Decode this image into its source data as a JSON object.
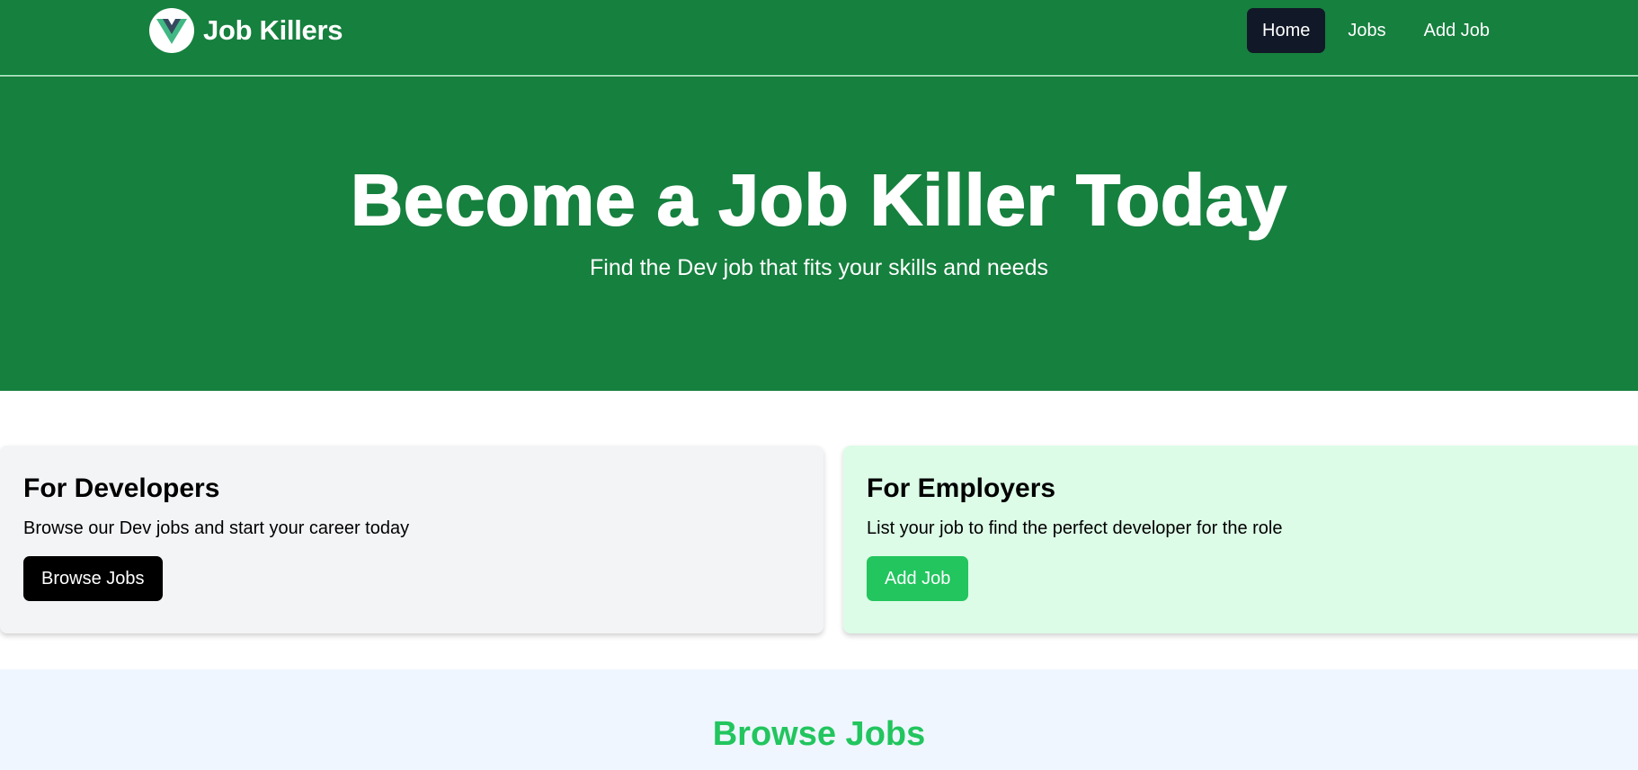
{
  "navbar": {
    "brand_name": "Job Killers",
    "logo_icon": "vue-logo-icon",
    "links": [
      {
        "label": "Home",
        "active": true
      },
      {
        "label": "Jobs",
        "active": false
      },
      {
        "label": "Add Job",
        "active": false
      }
    ]
  },
  "hero": {
    "title": "Become a Job Killer Today",
    "subtitle": "Find the Dev job that fits your skills and needs"
  },
  "cards": {
    "developers": {
      "title": "For Developers",
      "text": "Browse our Dev jobs and start your career today",
      "button_label": "Browse Jobs"
    },
    "employers": {
      "title": "For Employers",
      "text": "List your job to find the perfect developer for the role",
      "button_label": "Add Job"
    }
  },
  "browse": {
    "title": "Browse Jobs"
  },
  "colors": {
    "primary_green": "#16803e",
    "accent_green": "#22c55e",
    "dark_nav_active": "#111827",
    "card_gray": "#f3f4f6",
    "card_green": "#dcfce7",
    "browse_bg": "#eff6ff"
  }
}
